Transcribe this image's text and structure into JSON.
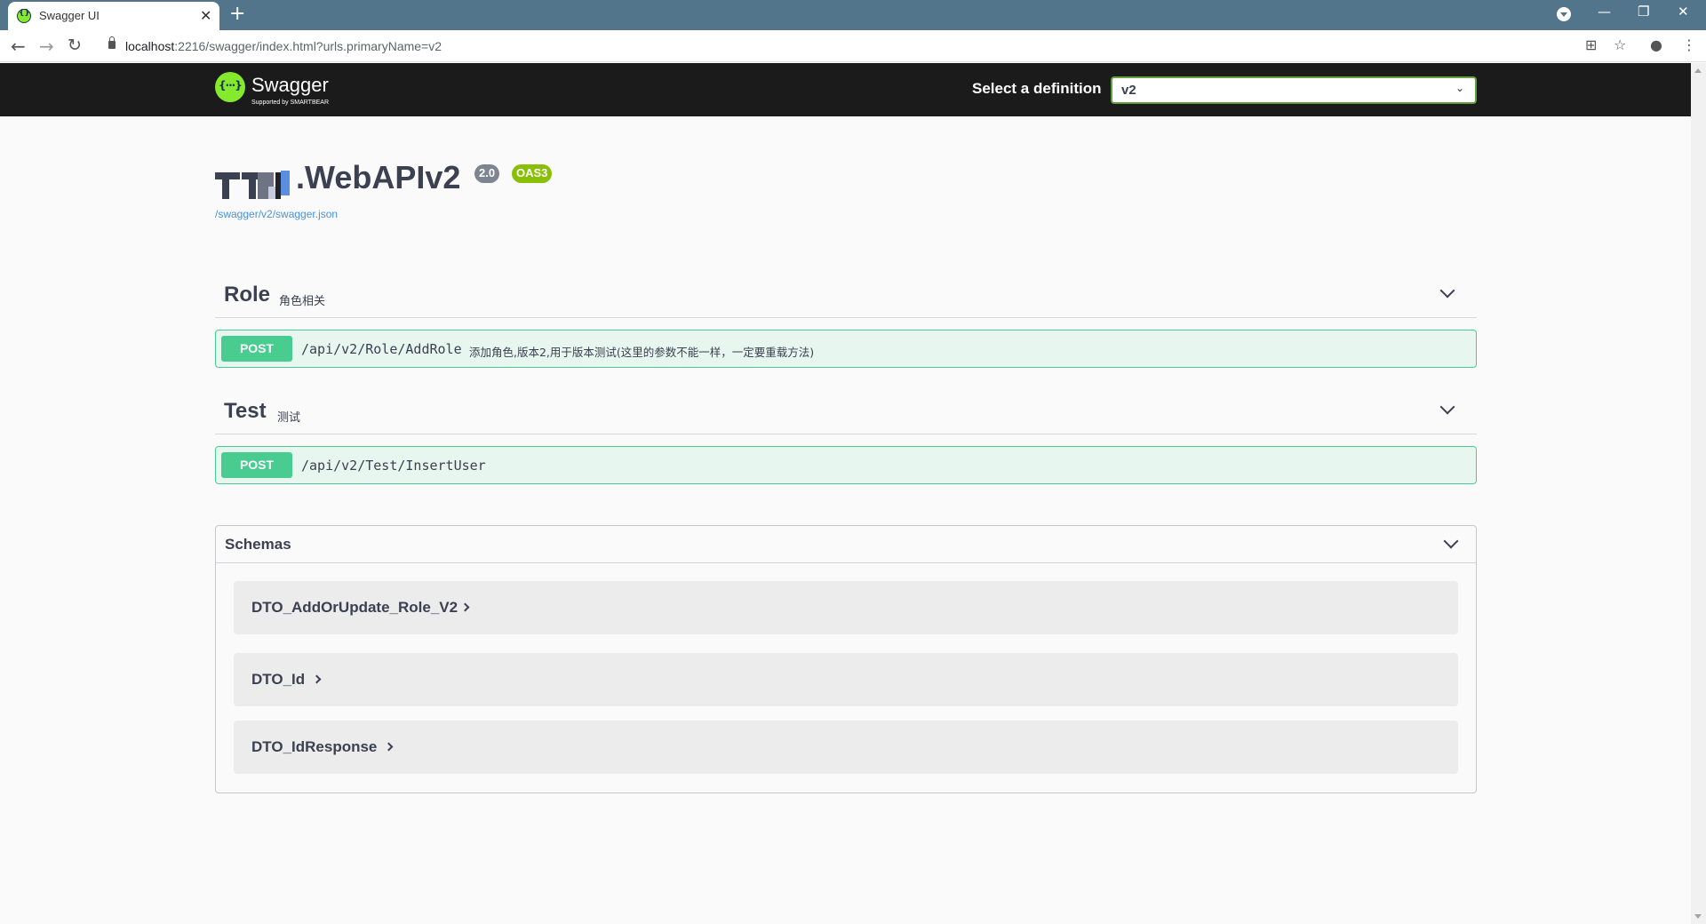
{
  "browser": {
    "tab_title": "Swagger UI",
    "url_host": "localhost",
    "url_rest": ":2216/swagger/index.html?urls.primaryName=v2"
  },
  "topbar": {
    "logo_text": "Swagger",
    "logo_sub": "Supported by SMARTBEAR",
    "definition_label": "Select a definition",
    "definition_value": "v2"
  },
  "info": {
    "title": ".WebAPIv2",
    "version": "2.0",
    "oas": "OAS3",
    "spec_link": "/swagger/v2/swagger.json"
  },
  "tags": [
    {
      "name": "Role",
      "description": "角色相关",
      "operations": [
        {
          "method": "POST",
          "path": "/api/v2/Role/AddRole",
          "summary": "添加角色,版本2,用于版本测试(这里的参数不能一样，一定要重载方法)"
        }
      ]
    },
    {
      "name": "Test",
      "description": "测试",
      "operations": [
        {
          "method": "POST",
          "path": "/api/v2/Test/InsertUser",
          "summary": ""
        }
      ]
    }
  ],
  "schemas": {
    "title": "Schemas",
    "models": [
      "DTO_AddOrUpdate_Role_V2",
      "DTO_Id",
      "DTO_IdResponse"
    ]
  },
  "colors": {
    "post": "#49cc90",
    "post_bg": "#e8f6f0",
    "topbar": "#1b1b1b",
    "logo": "#85ea2d",
    "browser_frame": "#53758c",
    "link": "#4990e2"
  }
}
